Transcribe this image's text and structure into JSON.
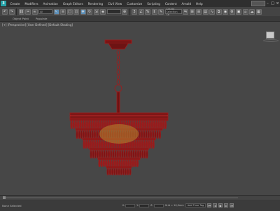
{
  "menubar": {
    "items": [
      "Create",
      "Modifiers",
      "Animation",
      "Graph Editors",
      "Rendering",
      "Civil View",
      "Customize",
      "Scripting",
      "Content",
      "Arnold",
      "Help"
    ]
  },
  "toolbar": {
    "selection_filter": "All",
    "named_selection": "Create Selection Se"
  },
  "ribbon": {
    "tabs": [
      "Object Paint",
      "Populate"
    ]
  },
  "viewport": {
    "label": "[+] [Perspective] [User Defined] [Default Shading]"
  },
  "statusbar": {
    "message": "None Selected",
    "x_label": "X:",
    "y_label": "Y:",
    "z_label": "Z:",
    "grid": "Grid = 10,0mm",
    "add_time_tag": "Add Time Tag"
  },
  "colors": {
    "wireframe": "#a01c1c",
    "viewport_bg": "#474747",
    "active_tool": "#5c8fb8"
  }
}
